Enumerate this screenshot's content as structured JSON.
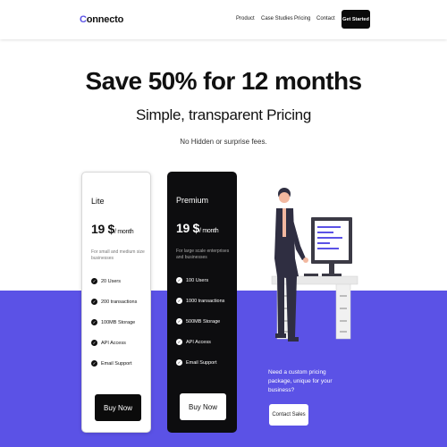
{
  "header": {
    "logo_initial": "C",
    "logo_rest": "onnecto",
    "nav": [
      "Product",
      "Case Studies",
      "Pricing",
      "Contact"
    ],
    "cta_label": "Get Started"
  },
  "hero": {
    "headline": "Save 50% for 12 months",
    "subhead": "Simple, transparent Pricing",
    "tagline": "No Hidden or surprise fees."
  },
  "plans": [
    {
      "name": "Lite",
      "price": "19 $",
      "period": "/ month",
      "description": "For small and medium size businesses",
      "features": [
        "20 Users",
        "200 transactions",
        "100MB Storage",
        "API Access",
        "Email Support"
      ],
      "button_label": "Buy Now"
    },
    {
      "name": "Premium",
      "price": "19 $",
      "period": "/ month",
      "description": "For large scale enterprises and businesses",
      "features": [
        "100 Users",
        "1000 transactions",
        "500MB Storage",
        "API Access",
        "Email Support"
      ],
      "button_label": "Buy Now"
    }
  ],
  "custom": {
    "text": "Need a custom pricing package, unique for your business?",
    "button_label": "Contact Sales"
  },
  "colors": {
    "accent": "#5b52e6",
    "dark": "#0d0d0f"
  }
}
